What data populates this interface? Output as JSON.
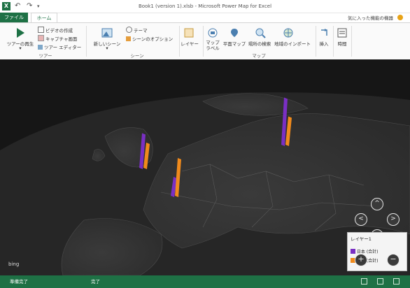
{
  "window": {
    "title": "Book1 (version 1).xlsb - Microsoft Power Map for Excel",
    "app_icon_label": "X"
  },
  "tabs": {
    "file": "ファイル",
    "home": "ホーム"
  },
  "favorites": "気に入った機能の機器",
  "ribbon": {
    "tour_group": {
      "play_tour": "ツアーの再生",
      "create_video": "ビデオの作成",
      "capture_screen": "キャプチャ画面",
      "tour_editor": "ツアー エディター",
      "label": "ツアー"
    },
    "scene_group": {
      "new_scene": "新しいシーン",
      "theme": "テーマ",
      "scene_options": "シーンのオプション",
      "label": "シーン"
    },
    "layer_group": {
      "layer": "レイヤー"
    },
    "map_group": {
      "map_labels": "マップ ラベル",
      "flat_map": "平面マップ",
      "find_location": "場所の検索",
      "import_regions": "地域のインポート",
      "label": "マップ"
    },
    "insert_group": {
      "insert": "挿入"
    },
    "time_group": {
      "time": "時間"
    }
  },
  "map": {
    "provider": "bing",
    "legend": {
      "title": "レイヤー1",
      "items": [
        {
          "label": "日本 (合計)",
          "color": "#7a2fc4"
        },
        {
          "label": "米国 (合計)",
          "color": "#f08a1c"
        }
      ]
    },
    "bars": [
      {
        "purple": 0.55,
        "orange": 0.4
      },
      {
        "purple": 0.3,
        "orange": 0.6
      },
      {
        "purple": 0.75,
        "orange": 0.45
      }
    ]
  },
  "status": {
    "left": "準備完了",
    "mid": "完了"
  },
  "colors": {
    "excel_green": "#1e7145",
    "purple": "#7a2fc4",
    "orange": "#f08a1c",
    "map_background": "#161616"
  }
}
